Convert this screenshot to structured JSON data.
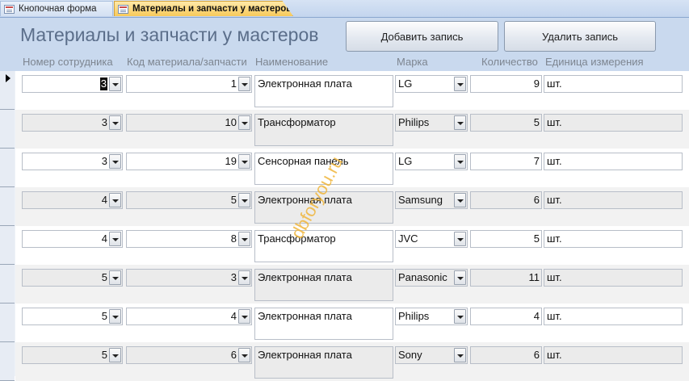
{
  "tabs": [
    {
      "label": "Кнопочная форма",
      "icon": "form-icon",
      "active": false
    },
    {
      "label": "Материалы и запчасти у мастеров",
      "icon": "form-icon",
      "active": true
    }
  ],
  "header": {
    "title": "Материалы и запчасти у мастеров",
    "add_button": "Добавить запись",
    "delete_button": "Удалить запись"
  },
  "columns": {
    "employee": "Номер сотрудника",
    "material_code": "Код материала/запчасти",
    "name": "Наименование",
    "brand": "Марка",
    "quantity": "Количество",
    "unit": "Единица измерения"
  },
  "records": [
    {
      "employee": "3",
      "code": "1",
      "name": "Электронная плата",
      "brand": "LG",
      "qty": "9",
      "unit": "шт."
    },
    {
      "employee": "3",
      "code": "10",
      "name": "Трансформатор",
      "brand": "Philips",
      "qty": "5",
      "unit": "шт."
    },
    {
      "employee": "3",
      "code": "19",
      "name": "Сенсорная панель",
      "brand": "LG",
      "qty": "7",
      "unit": "шт."
    },
    {
      "employee": "4",
      "code": "5",
      "name": "Электронная плата",
      "brand": "Samsung",
      "qty": "6",
      "unit": "шт."
    },
    {
      "employee": "4",
      "code": "8",
      "name": "Трансформатор",
      "brand": "JVC",
      "qty": "5",
      "unit": "шт."
    },
    {
      "employee": "5",
      "code": "3",
      "name": "Электронная плата",
      "brand": "Panasonic",
      "qty": "11",
      "unit": "шт."
    },
    {
      "employee": "5",
      "code": "4",
      "name": "Электронная плата",
      "brand": "Philips",
      "qty": "4",
      "unit": "шт."
    },
    {
      "employee": "5",
      "code": "6",
      "name": "Электронная плата",
      "brand": "Sony",
      "qty": "6",
      "unit": "шт."
    }
  ],
  "watermark": "dbforyou.ru",
  "colors": {
    "header_bg": "#c9d9ee",
    "active_tab": "#f7c95a",
    "watermark": "#f0b63b"
  }
}
